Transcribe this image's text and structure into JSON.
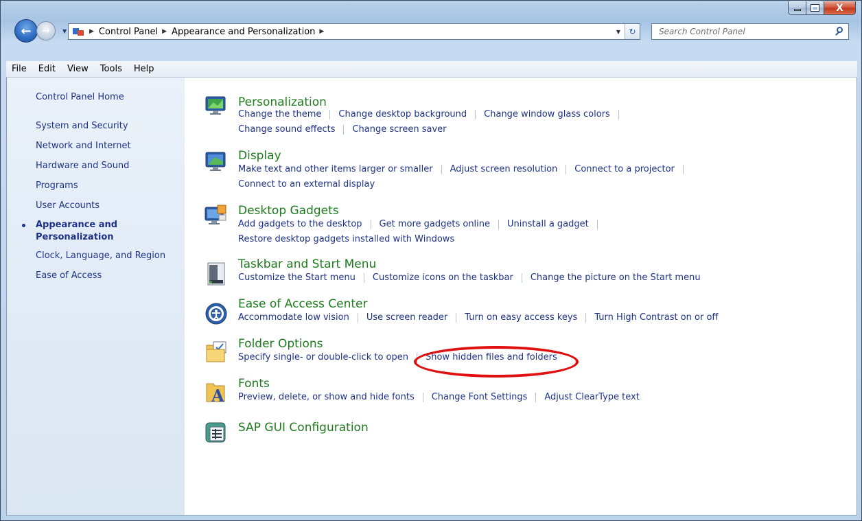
{
  "window": {
    "caption": {
      "minimize": "—",
      "maximize": "□",
      "close": "X"
    }
  },
  "address": {
    "crumbs": [
      "Control Panel",
      "Appearance and Personalization"
    ],
    "search_placeholder": "Search Control Panel"
  },
  "menu": [
    "File",
    "Edit",
    "View",
    "Tools",
    "Help"
  ],
  "sidebar": {
    "home": "Control Panel Home",
    "items": [
      "System and Security",
      "Network and Internet",
      "Hardware and Sound",
      "Programs",
      "User Accounts"
    ],
    "current_line1": "Appearance and",
    "current_line2": "Personalization",
    "items_after": [
      "Clock, Language, and Region",
      "Ease of Access"
    ]
  },
  "categories": [
    {
      "title": "Personalization",
      "icon": "personalization-icon",
      "rows": [
        [
          "Change the theme",
          "Change desktop background",
          "Change window glass colors"
        ],
        [
          "Change sound effects",
          "Change screen saver"
        ]
      ]
    },
    {
      "title": "Display",
      "icon": "display-icon",
      "rows": [
        [
          "Make text and other items larger or smaller",
          "Adjust screen resolution",
          "Connect to a projector"
        ],
        [
          "Connect to an external display"
        ]
      ]
    },
    {
      "title": "Desktop Gadgets",
      "icon": "gadgets-icon",
      "rows": [
        [
          "Add gadgets to the desktop",
          "Get more gadgets online",
          "Uninstall a gadget"
        ],
        [
          "Restore desktop gadgets installed with Windows"
        ]
      ]
    },
    {
      "title": "Taskbar and Start Menu",
      "icon": "taskbar-icon",
      "rows": [
        [
          "Customize the Start menu",
          "Customize icons on the taskbar",
          "Change the picture on the Start menu"
        ]
      ]
    },
    {
      "title": "Ease of Access Center",
      "icon": "ease-of-access-icon",
      "rows": [
        [
          "Accommodate low vision",
          "Use screen reader",
          "Turn on easy access keys",
          "Turn High Contrast on or off"
        ]
      ]
    },
    {
      "title": "Folder Options",
      "icon": "folder-options-icon",
      "rows": [
        [
          "Specify single- or double-click to open",
          "Show hidden files and folders"
        ]
      ]
    },
    {
      "title": "Fonts",
      "icon": "fonts-icon",
      "rows": [
        [
          "Preview, delete, or show and hide fonts",
          "Change Font Settings",
          "Adjust ClearType text"
        ]
      ]
    },
    {
      "title": "SAP GUI Configuration",
      "icon": "sap-gui-icon",
      "rows": []
    }
  ],
  "colors": {
    "link": "#1e3287",
    "category_title": "#1e7b1e",
    "annotation": "#e01010"
  }
}
